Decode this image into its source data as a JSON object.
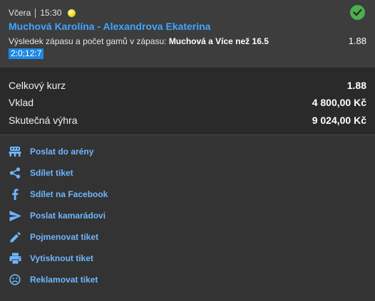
{
  "ticket": {
    "day": "Včera",
    "time": "15:30",
    "sport_icon": "tennis-ball-icon",
    "status_icon": "check-circle-icon",
    "match": "Muchová Karolína - Alexandrova Ekaterina",
    "market": "Výsledek zápasu a počet gamů v zápasu: ",
    "selection": "Muchová a Více než 16.5",
    "odds": "1.88",
    "score": "2:0;12:7"
  },
  "summary": {
    "total_odds_label": "Celkový kurz",
    "total_odds_value": "1.88",
    "stake_label": "Vklad",
    "stake_value": "4 800,00 Kč",
    "win_label": "Skutečná výhra",
    "win_value": "9 024,00 Kč"
  },
  "actions": [
    {
      "label": "Poslat do arény",
      "icon": "arena-icon"
    },
    {
      "label": "Sdílet tiket",
      "icon": "share-icon"
    },
    {
      "label": "Sdílet na Facebook",
      "icon": "facebook-icon"
    },
    {
      "label": "Poslat kamarádovi",
      "icon": "send-icon"
    },
    {
      "label": "Pojmenovat tiket",
      "icon": "pencil-icon"
    },
    {
      "label": "Vytisknout tiket",
      "icon": "print-icon"
    },
    {
      "label": "Reklamovat tiket",
      "icon": "sad-face-icon"
    }
  ],
  "colors": {
    "accent": "#3ea6ff",
    "success": "#4caf50",
    "badge": "#1e88e5",
    "link": "#6fb6ff"
  }
}
